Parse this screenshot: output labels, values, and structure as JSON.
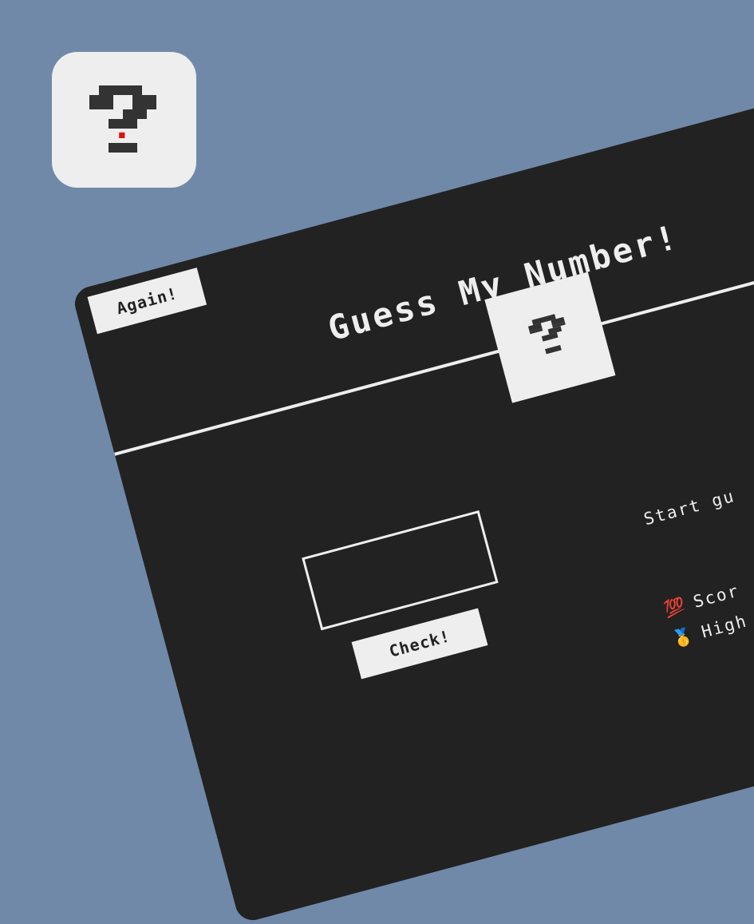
{
  "app_icon": {
    "name": "question-mark-icon"
  },
  "game": {
    "again_label": "Again!",
    "title": "Guess My Number!",
    "secret_placeholder": "?",
    "guess_value": "",
    "check_label": "Check!",
    "message": "Start gu",
    "score": {
      "emoji": "💯",
      "label": "Scor"
    },
    "highscore": {
      "emoji": "🥇",
      "label": "High"
    }
  },
  "colors": {
    "background": "#7189a8",
    "panel": "#222222",
    "light": "#eeeeee",
    "accent_dot": "#e01010"
  }
}
